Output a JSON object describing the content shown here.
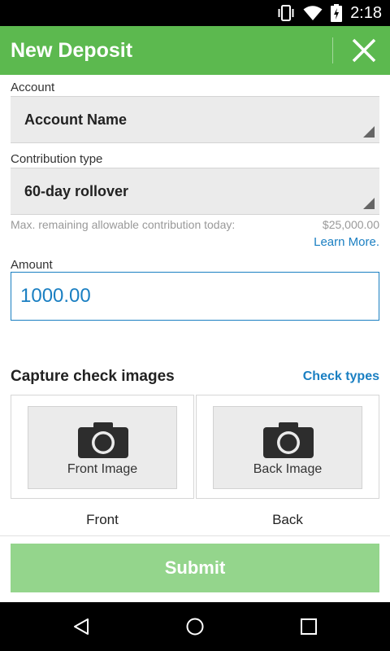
{
  "status_bar": {
    "time": "2:18"
  },
  "app_bar": {
    "title": "New Deposit"
  },
  "account": {
    "label": "Account",
    "value": "Account Name"
  },
  "contribution": {
    "label": "Contribution type",
    "value": "60-day rollover",
    "hint": "Max. remaining allowable contribution today:",
    "hint_amount": "$25,000.00",
    "learn_more": "Learn More."
  },
  "amount": {
    "label": "Amount",
    "value": "1000.00"
  },
  "capture": {
    "title": "Capture check images",
    "check_types": "Check types",
    "front": {
      "button_label": "Front Image",
      "caption": "Front"
    },
    "back": {
      "button_label": "Back Image",
      "caption": "Back"
    }
  },
  "submit": {
    "label": "Submit"
  },
  "colors": {
    "brand_green": "#5cb94f",
    "submit_disabled": "#94d58c",
    "link_blue": "#1a7fc2"
  },
  "icons": [
    "vibrate-icon",
    "wifi-icon",
    "battery-icon",
    "close-icon",
    "camera-icon",
    "back-nav-icon",
    "home-nav-icon",
    "recents-nav-icon"
  ]
}
